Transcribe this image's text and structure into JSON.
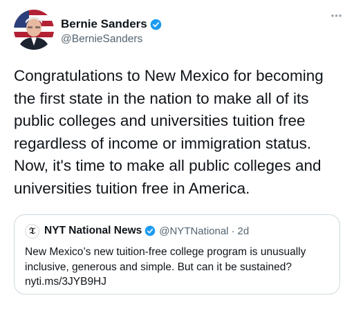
{
  "author": {
    "display_name": "Bernie Sanders",
    "handle": "@BernieSanders",
    "avatar_icon": "bernie-sanders-photo",
    "verified_icon": "verified-badge-icon",
    "verified_color": "#1d9bf0"
  },
  "menu_icon": "more-options-icon",
  "tweet": {
    "text": "Congratulations to New Mexico for becoming the first state in the nation to make all of its public colleges and universities tuition free regardless of income or immigration status. Now, it's time to make all public colleges and universities tuition free in America."
  },
  "quoted_tweet": {
    "logo_icon": "nyt-logo-icon",
    "display_name": "NYT National News",
    "handle": "@NYTNational",
    "separator": "·",
    "time": "2d",
    "text": "New Mexico’s new tuition-free college program is unusually inclusive, generous and simple. But can it be sustained? nyti.ms/3JYB9HJ"
  }
}
